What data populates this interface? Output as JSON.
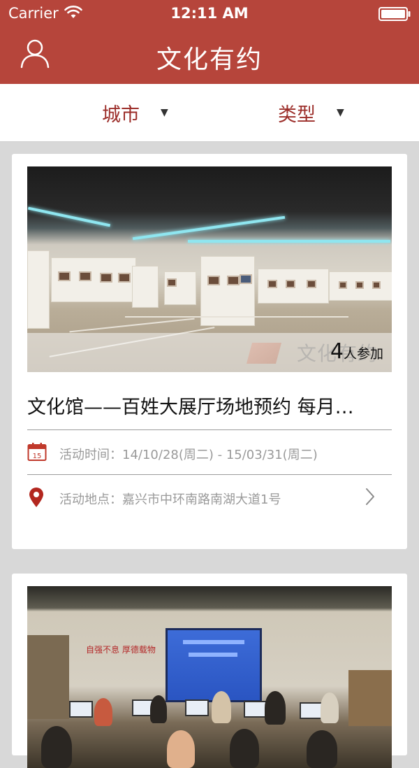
{
  "status_bar": {
    "carrier": "Carrier",
    "time": "12:11 AM"
  },
  "nav": {
    "title": "文化有约",
    "left_icon": "user-icon"
  },
  "filters": {
    "city": "城市",
    "type": "类型",
    "arrow": "▼"
  },
  "cards": [
    {
      "participants_count": "4",
      "participants_suffix": "人参加",
      "watermark": "文化有约",
      "title": "文化馆——百姓大展厅场地预约 每月…",
      "time_label": "活动时间：",
      "time_value": "14/10/28(周二) - 15/03/31(周二)",
      "place_label": "活动地点：",
      "place_value": "嘉兴市中环南路南湖大道1号",
      "calendar_day": "15"
    },
    {
      "sign_text": "自强不息 厚德载物"
    }
  ],
  "colors": {
    "brand_red": "#b6453b",
    "filter_text": "#9c2e2a",
    "background": "#d8d8d8"
  }
}
